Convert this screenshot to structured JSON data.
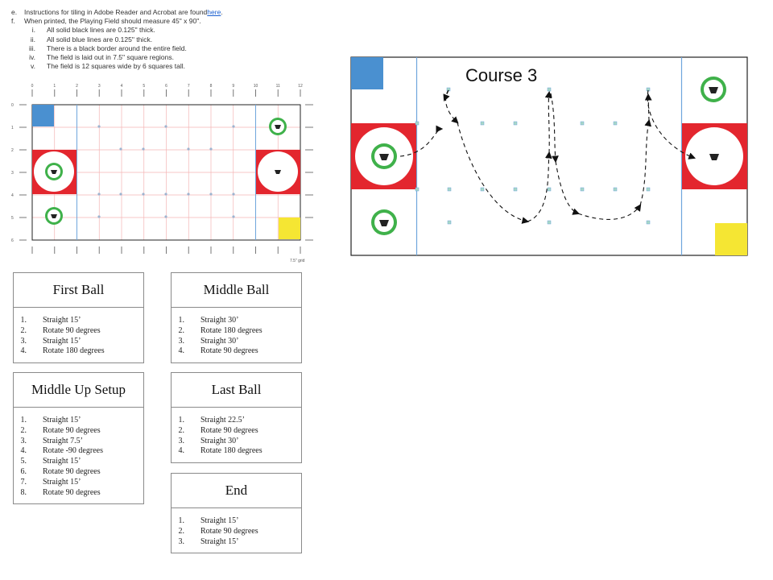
{
  "instructions": [
    {
      "marker": "e.",
      "text": "Instructions for tiling in Adobe Reader and Acrobat are found ",
      "link": "here",
      "suffix": "."
    },
    {
      "marker": "f.",
      "text": "When printed, the Playing Field should measure 45\" x 90\"."
    }
  ],
  "subitems": [
    {
      "marker": "i.",
      "text": "All solid black lines are 0.125\" thick."
    },
    {
      "marker": "ii.",
      "text": "All solid blue lines are 0.125\" thick."
    },
    {
      "marker": "iii.",
      "text": "There is a black border around the entire field."
    },
    {
      "marker": "iv.",
      "text": "The field is laid out in 7.5\" square regions."
    },
    {
      "marker": "v.",
      "text": "The field is 12 squares wide by 6 squares tall."
    }
  ],
  "field": {
    "col_labels": [
      "0",
      "1",
      "2",
      "3",
      "4",
      "5",
      "6",
      "7",
      "8",
      "9",
      "10",
      "11",
      "12"
    ],
    "row_labels": [
      "0",
      "1",
      "2",
      "3",
      "4",
      "5",
      "6"
    ],
    "grid_note": "7.5\" grid",
    "colors": {
      "blue_zone": "#4a90d0",
      "red_zone": "#e3262e",
      "yellow_zone": "#f5e633",
      "target_green": "#3fb14a",
      "grid_red": "#f4b5b5",
      "grid_blue": "#8ab6e0"
    }
  },
  "course": {
    "title": "Course 3"
  },
  "cards": [
    {
      "title": "First Ball",
      "steps": [
        {
          "n": "1.",
          "text": "Straight 15’"
        },
        {
          "n": "2.",
          "text": "Rotate 90 degrees"
        },
        {
          "n": "3.",
          "text": "Straight 15’"
        },
        {
          "n": "4.",
          "text": "Rotate 180 degrees"
        }
      ]
    },
    {
      "title": "Middle Ball",
      "steps": [
        {
          "n": "1.",
          "text": "Straight 30’"
        },
        {
          "n": "2.",
          "text": "Rotate 180 degrees"
        },
        {
          "n": "3.",
          "text": "Straight 30’"
        },
        {
          "n": "4.",
          "text": "Rotate 90 degrees"
        }
      ]
    },
    {
      "title": "Middle Up Setup",
      "steps": [
        {
          "n": "1.",
          "text": "Straight 15’"
        },
        {
          "n": "2.",
          "text": "Rotate 90 degrees"
        },
        {
          "n": "3.",
          "text": "Straight 7.5’"
        },
        {
          "n": "4.",
          "text": "Rotate -90 degrees"
        },
        {
          "n": "5.",
          "text": "Straight 15’"
        },
        {
          "n": "6.",
          "text": "Rotate 90 degrees"
        },
        {
          "n": "7.",
          "text": "Straight 15’"
        },
        {
          "n": "8.",
          "text": "Rotate 90 degrees"
        }
      ]
    },
    {
      "title": "Last Ball",
      "steps": [
        {
          "n": "1.",
          "text": "Straight 22.5’"
        },
        {
          "n": "2.",
          "text": "Rotate 90 degrees"
        },
        {
          "n": "3.",
          "text": "Straight 30’"
        },
        {
          "n": "4.",
          "text": "Rotate 180 degrees"
        }
      ]
    },
    {
      "title": "End",
      "steps": [
        {
          "n": "1.",
          "text": "Straight 15’"
        },
        {
          "n": "2.",
          "text": "Rotate 90 degrees"
        },
        {
          "n": "3.",
          "text": "Straight 15’"
        }
      ]
    }
  ]
}
